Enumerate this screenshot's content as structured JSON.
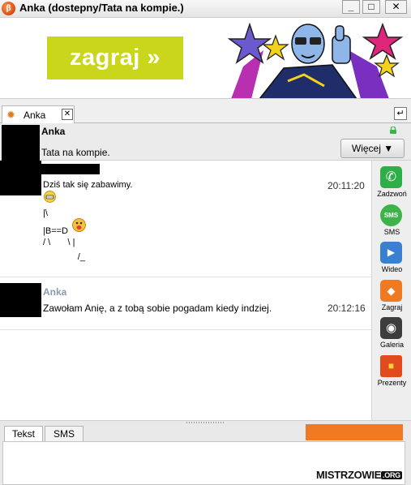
{
  "window": {
    "title": "Anka  (dostepny/Tata na kompie.)",
    "app_icon_glyph": "β",
    "minimize": "_",
    "maximize": "□",
    "close": "✕"
  },
  "ad": {
    "button_label": "zagraj »"
  },
  "tabs": [
    {
      "label": "Anka",
      "close": "✕"
    }
  ],
  "detach_glyph": "↵",
  "contact": {
    "name": "Anka",
    "status": "Tata na kompie.",
    "more_button": "Więcej ▼",
    "lock_color": "#3bb24a"
  },
  "messages": [
    {
      "sender": "",
      "text": "Dziś tak się zabawimy.",
      "time": "20:11:20",
      "ascii": [
        "|\\",
        "|B==D",
        "/ \\       \\ |",
        "              /_"
      ]
    },
    {
      "sender": "Anka",
      "text": "Zawołam Anię, a z tobą sobie pogadam kiedy indziej.",
      "time": "20:12:16"
    }
  ],
  "sidebar": [
    {
      "label": "Zadzwoń",
      "icon": "phone-icon",
      "glyph": "✆",
      "color": "#2fae48"
    },
    {
      "label": "SMS",
      "icon": "sms-icon",
      "glyph": "SMS",
      "color": "#3cb44a"
    },
    {
      "label": "Wideo",
      "icon": "video-icon",
      "glyph": "▶",
      "color": "#3a7fd1"
    },
    {
      "label": "Zagraj",
      "icon": "game-icon",
      "glyph": "◆",
      "color": "#ef7a22"
    },
    {
      "label": "Galeria",
      "icon": "camera-icon",
      "glyph": "◉",
      "color": "#3d3d3d"
    },
    {
      "label": "Prezenty",
      "icon": "gift-icon",
      "glyph": "■",
      "color": "#e14a1c"
    }
  ],
  "input": {
    "tabs": [
      "Tekst",
      "SMS"
    ],
    "watermark": "MISTRZOWIE",
    "watermark_suffix": ".ORG"
  }
}
